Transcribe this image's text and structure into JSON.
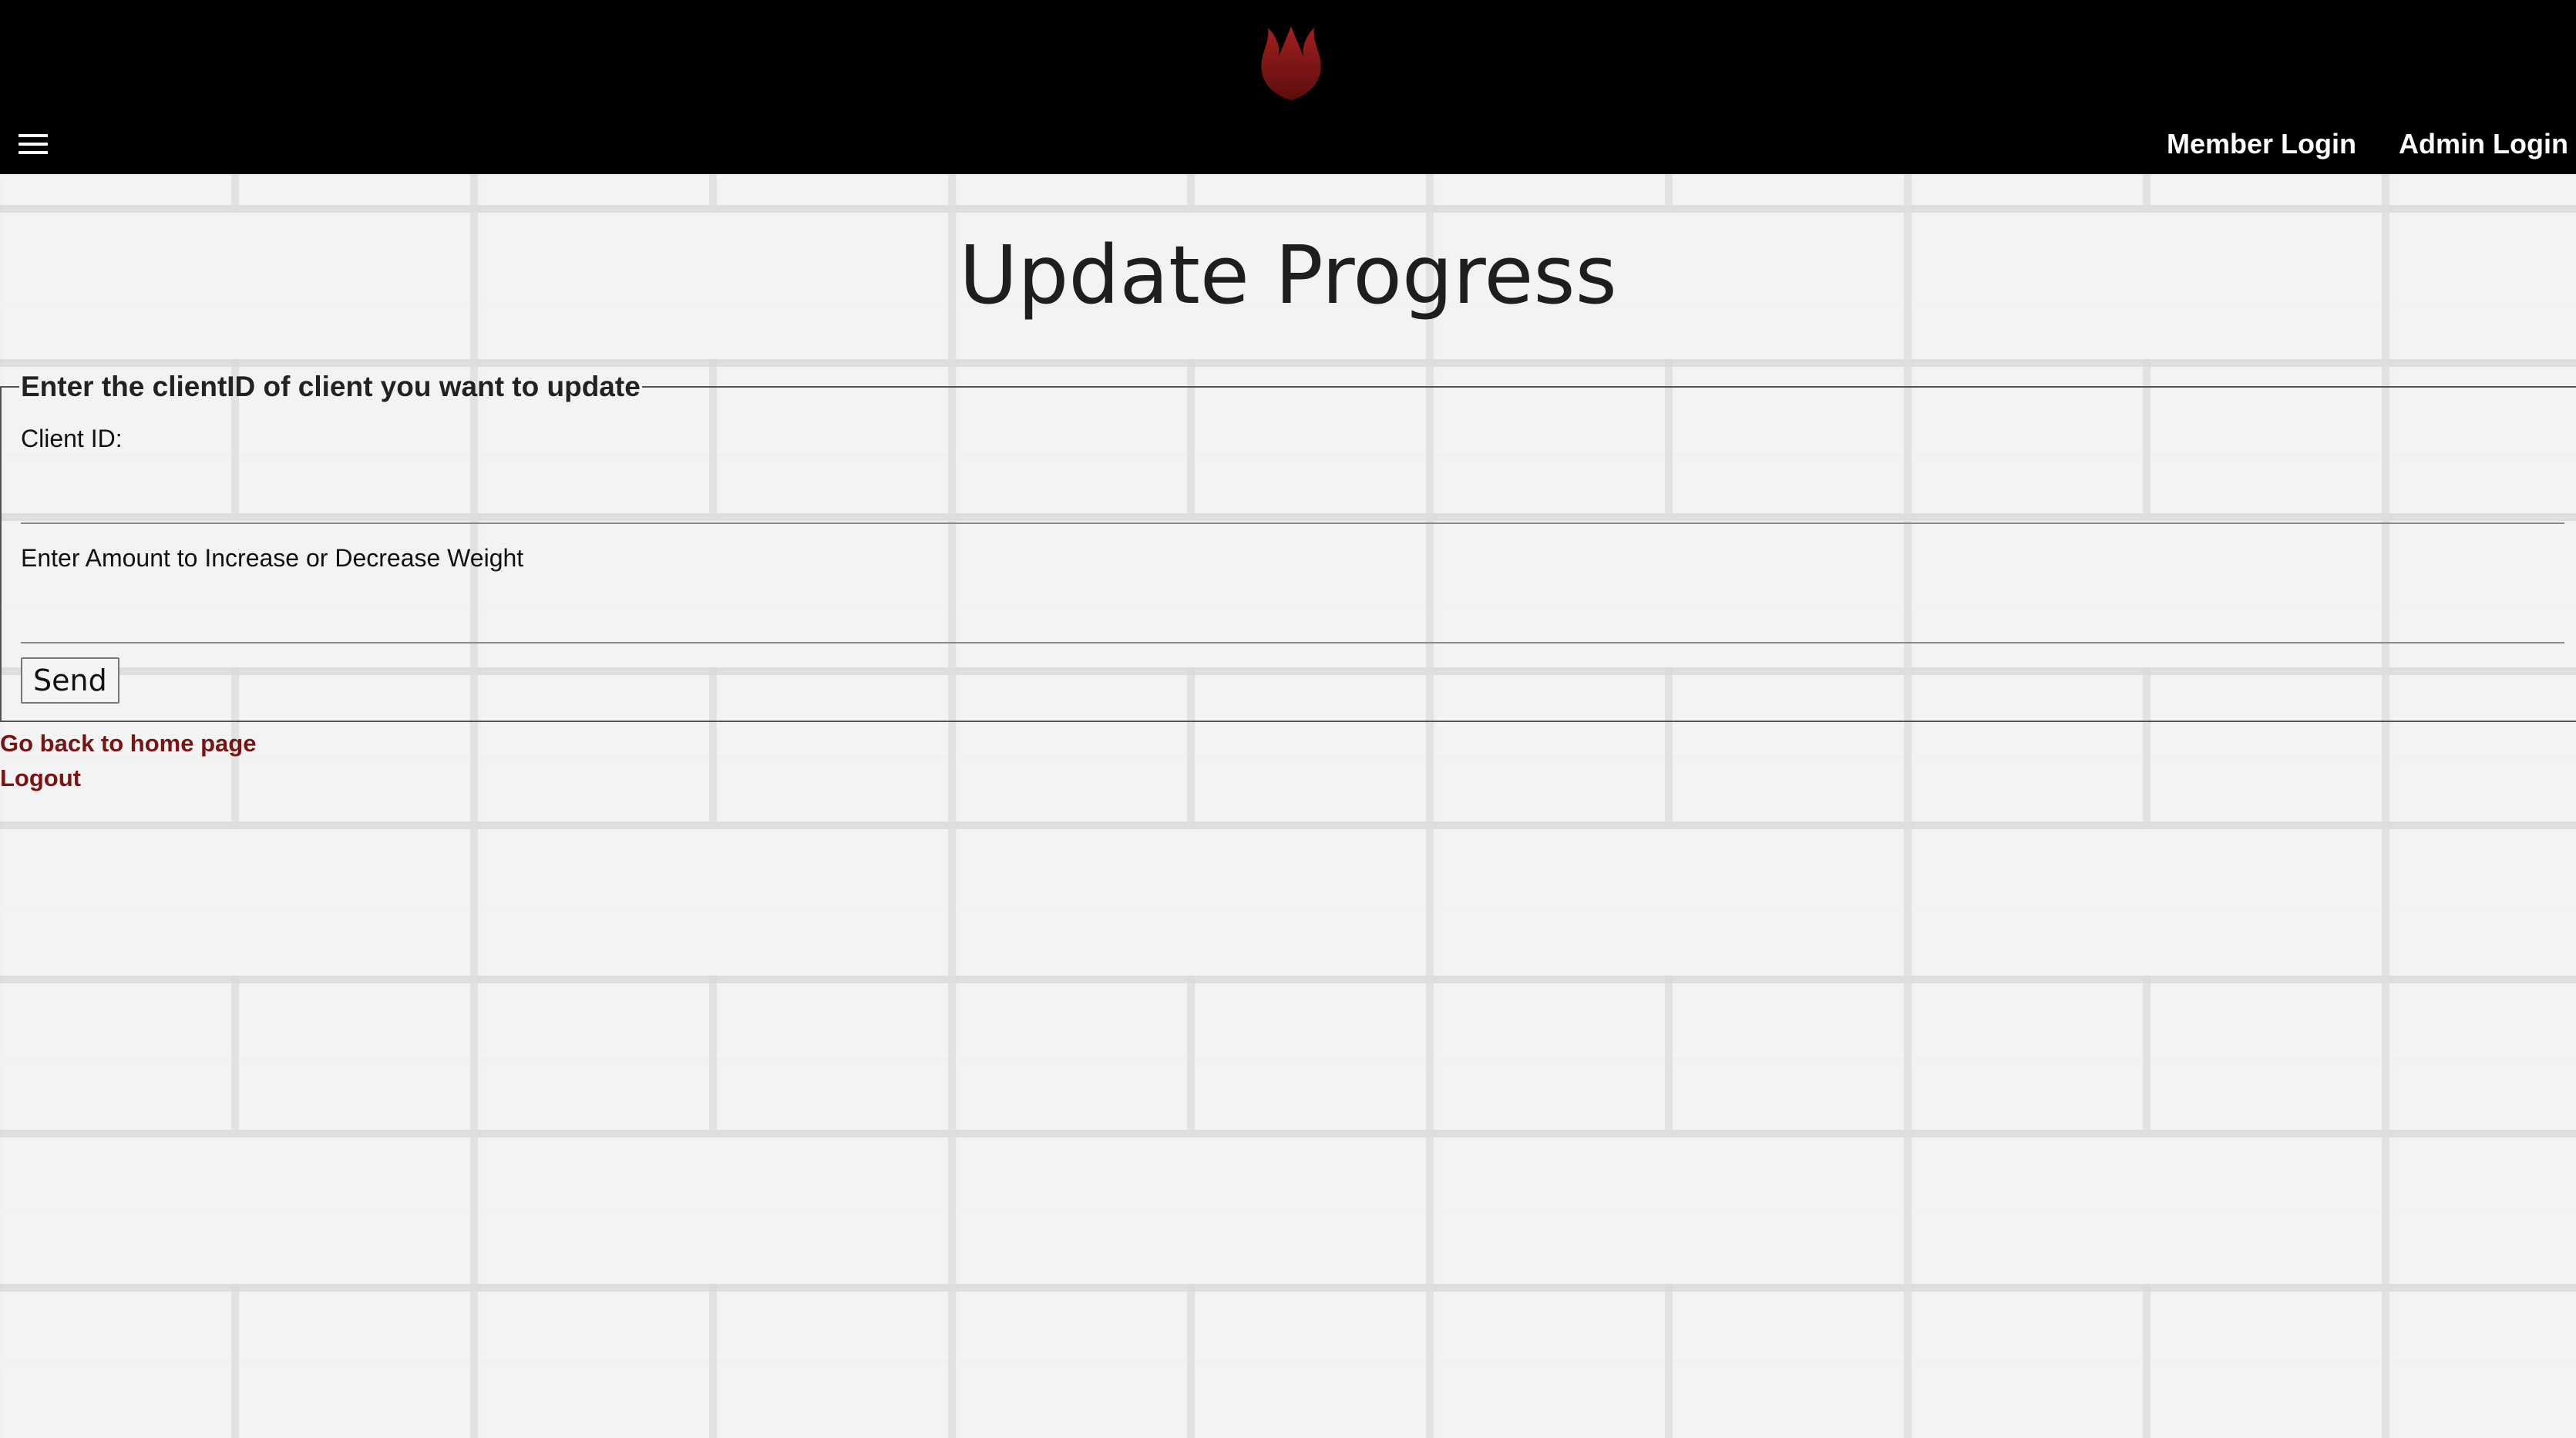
{
  "header": {
    "logo_icon": "red-flame-logo-icon",
    "menu_icon": "hamburger-menu-icon",
    "nav": [
      {
        "label": "Member Login"
      },
      {
        "label": "Admin Login"
      }
    ]
  },
  "main": {
    "title": "Update Progress",
    "form": {
      "legend": "Enter the clientID of client you want to update",
      "client_id_label": "Client ID:",
      "client_id_value": "",
      "amount_label": "Enter Amount to Increase or Decrease Weight",
      "amount_value": "",
      "send_label": "Send"
    },
    "links": {
      "home": "Go back to home page",
      "logout": "Logout"
    }
  },
  "colors": {
    "header_bg": "#000000",
    "link_red": "#7a1414",
    "logo_red": "#8b1a1a"
  }
}
